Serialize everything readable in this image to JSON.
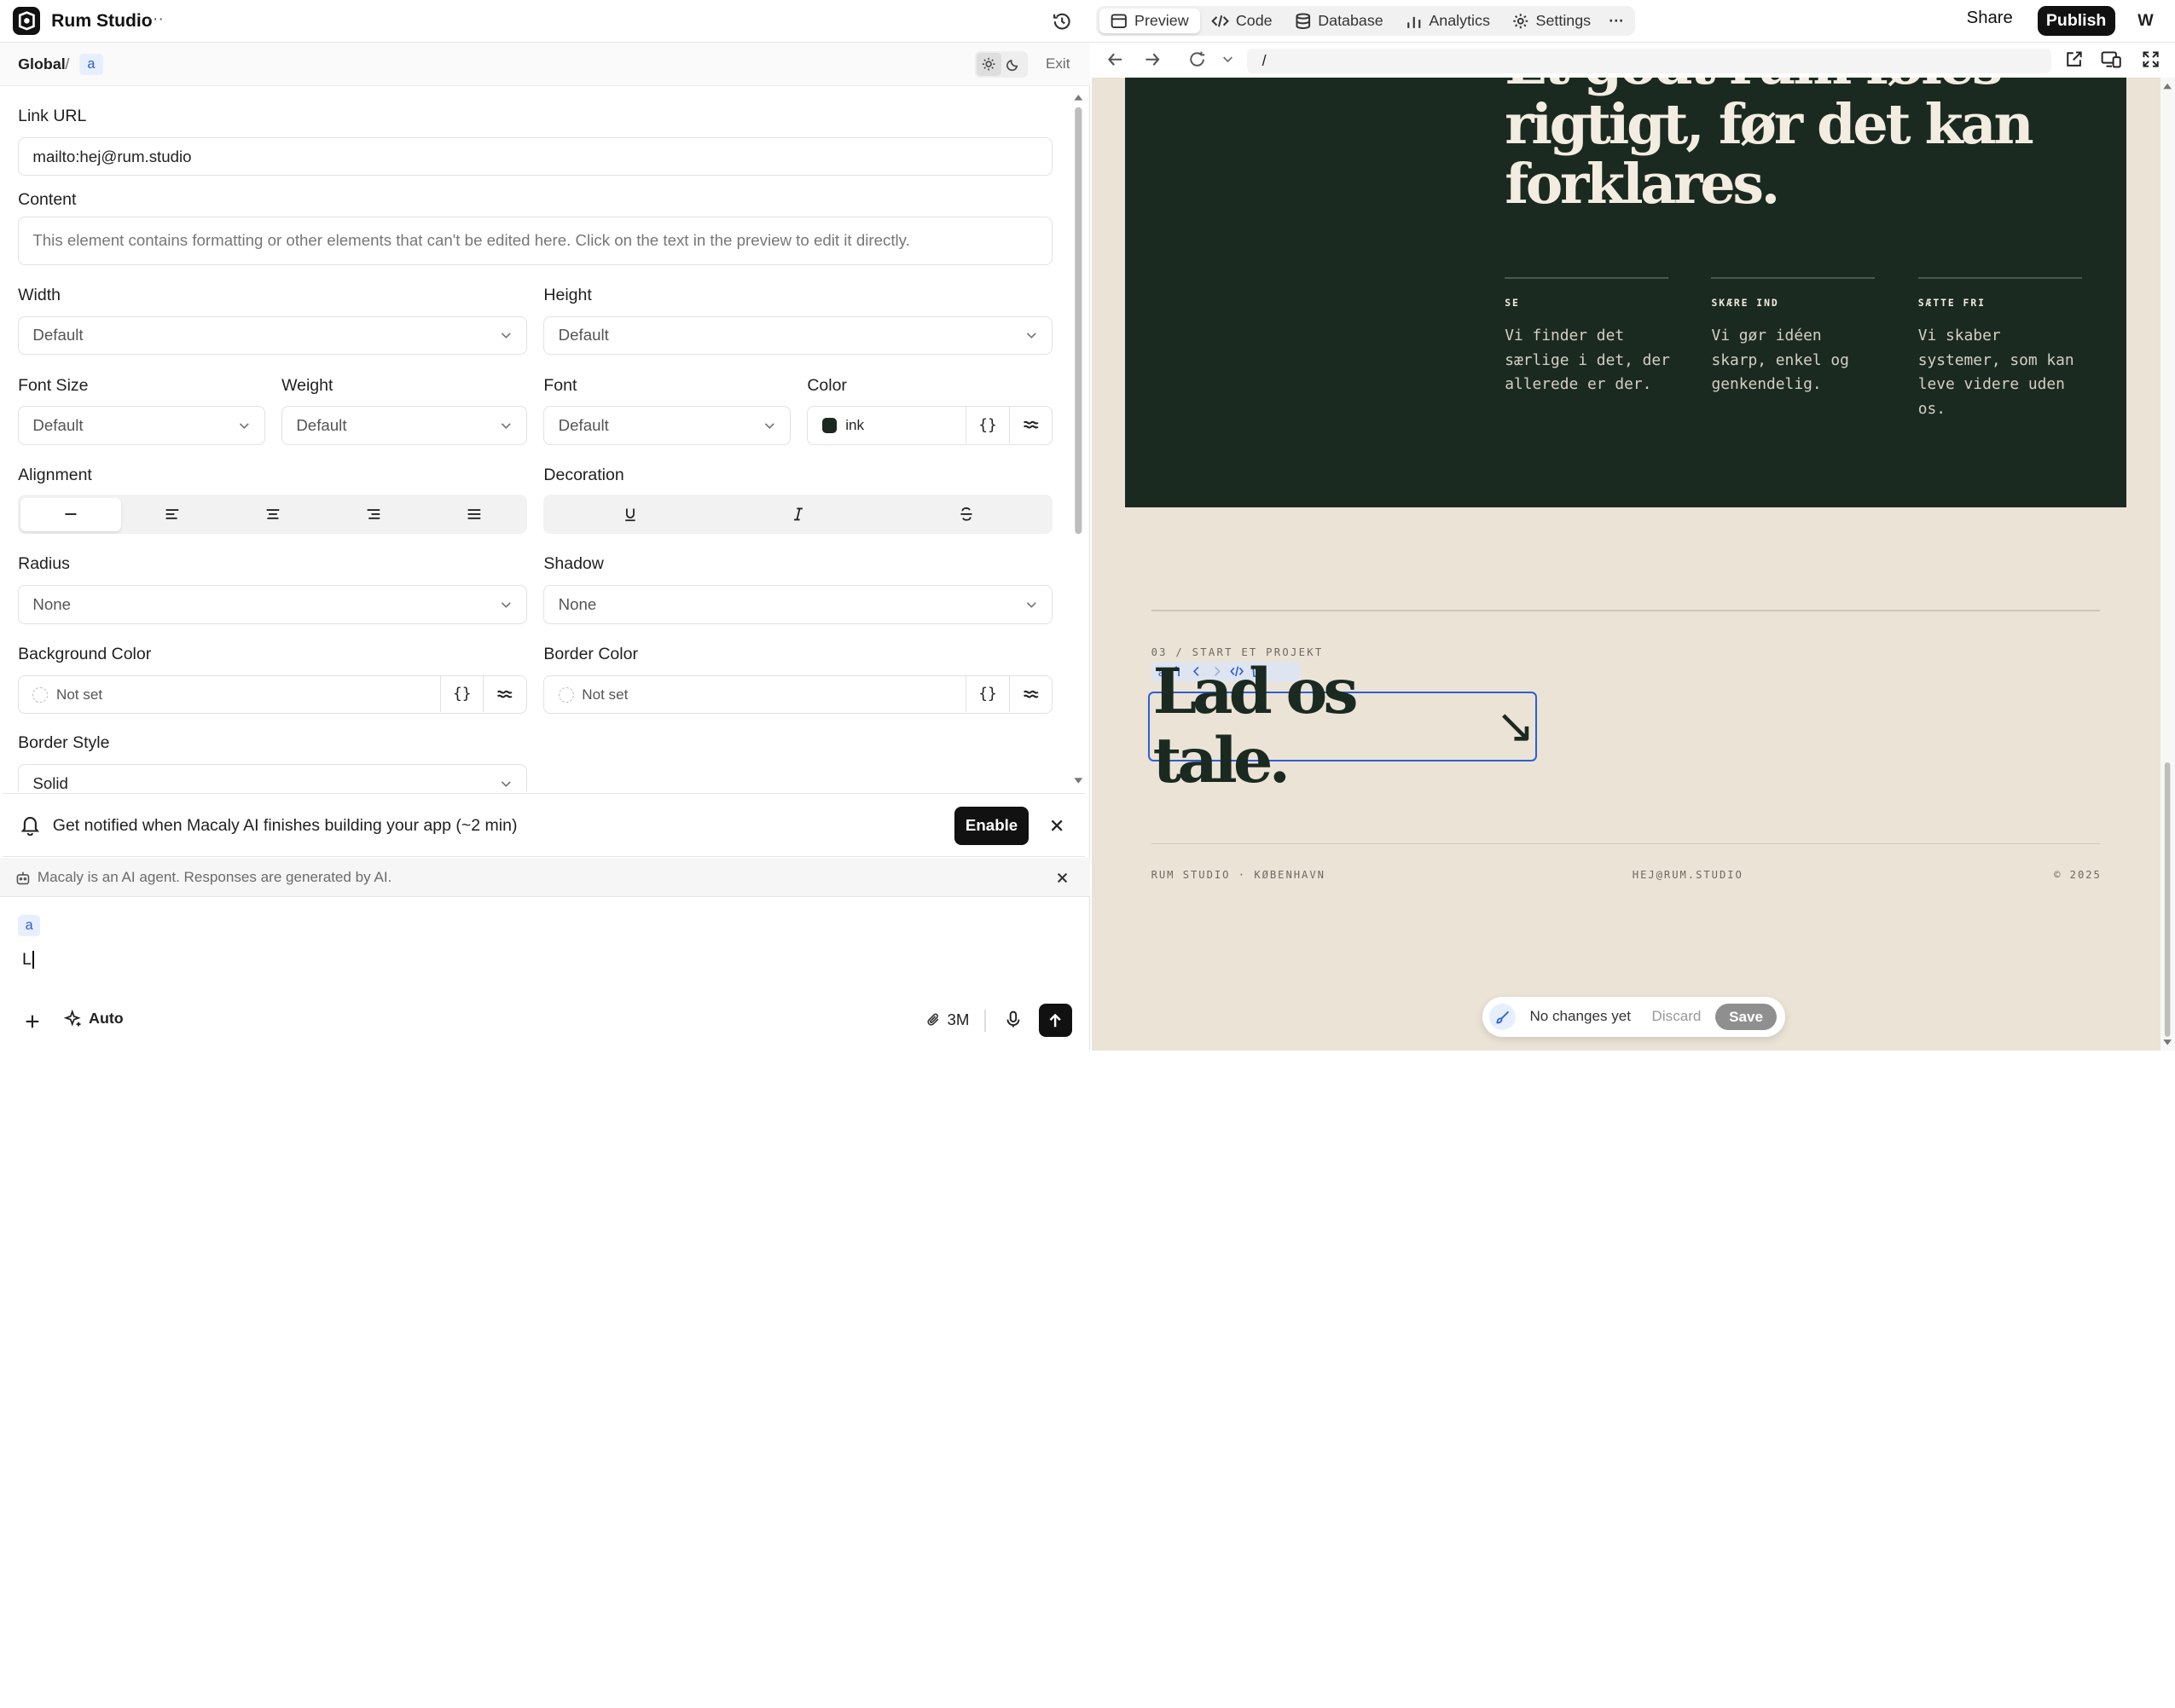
{
  "app": {
    "name": "Rum Studio",
    "more_label": "···"
  },
  "tabs": [
    {
      "label": "Preview",
      "icon": "preview-icon",
      "active": true
    },
    {
      "label": "Code",
      "icon": "code-icon"
    },
    {
      "label": "Database",
      "icon": "database-icon"
    },
    {
      "label": "Analytics",
      "icon": "analytics-icon"
    },
    {
      "label": "Settings",
      "icon": "gear-icon"
    }
  ],
  "header": {
    "share_label": "Share",
    "publish_label": "Publish",
    "avatar_initial": "W"
  },
  "breadcrumb": {
    "root": "Global",
    "separator": "/",
    "current": "a",
    "exit_label": "Exit"
  },
  "properties": {
    "link_url": {
      "label": "Link URL",
      "value": "mailto:hej@rum.studio"
    },
    "content": {
      "label": "Content",
      "placeholder": "This element contains formatting or other elements that can't be edited here. Click on the text in the preview to edit it directly."
    },
    "width": {
      "label": "Width",
      "value": "Default"
    },
    "height": {
      "label": "Height",
      "value": "Default"
    },
    "font_size": {
      "label": "Font Size",
      "value": "Default"
    },
    "weight": {
      "label": "Weight",
      "value": "Default"
    },
    "font": {
      "label": "Font",
      "value": "Default"
    },
    "color": {
      "label": "Color",
      "value": "ink",
      "swatch": "#1b2a21",
      "expr_label": "{}"
    },
    "alignment": {
      "label": "Alignment"
    },
    "decoration": {
      "label": "Decoration"
    },
    "radius": {
      "label": "Radius",
      "value": "None"
    },
    "shadow": {
      "label": "Shadow",
      "value": "None"
    },
    "background_color": {
      "label": "Background Color",
      "value": "Not set",
      "expr_label": "{}"
    },
    "border_color": {
      "label": "Border Color",
      "value": "Not set",
      "expr_label": "{}"
    },
    "border_style": {
      "label": "Border Style",
      "value": "Solid"
    }
  },
  "notification": {
    "text": "Get notified when Macaly AI finishes building your app (~2 min)",
    "enable_label": "Enable"
  },
  "disclaimer": {
    "text": "Macaly is an AI agent. Responses are generated by AI."
  },
  "chat": {
    "context_chip": "a",
    "input_value": "L",
    "mode_label": "Auto",
    "token_count": "3M"
  },
  "browser": {
    "url": "/"
  },
  "preview": {
    "headline": "Et godt rum føles rigtigt, før det kan forklares.",
    "columns": [
      {
        "title": "SE",
        "body": "Vi finder det særlige i det, der allerede er der."
      },
      {
        "title": "SKÆRE IND",
        "body": "Vi gør idéen skarp, enkel og genkendelig."
      },
      {
        "title": "SÆTTE FRI",
        "body": "Vi skaber systemer, som kan leve videre uden os."
      }
    ],
    "section_label": "03 / START ET PROJEKT",
    "toolbar_tag": "a",
    "cta": "Lad os tale.",
    "cta_arrow": "↘",
    "footer_left": "RUM STUDIO · KØBENHAVN",
    "footer_center": "HEJ@RUM.STUDIO",
    "footer_right": "© 2025",
    "colors": {
      "dark": "#1b2a21",
      "cream": "#ebe3d6",
      "selection": "#2f5fd0"
    }
  },
  "savebar": {
    "status": "No changes yet",
    "discard_label": "Discard",
    "save_label": "Save"
  }
}
